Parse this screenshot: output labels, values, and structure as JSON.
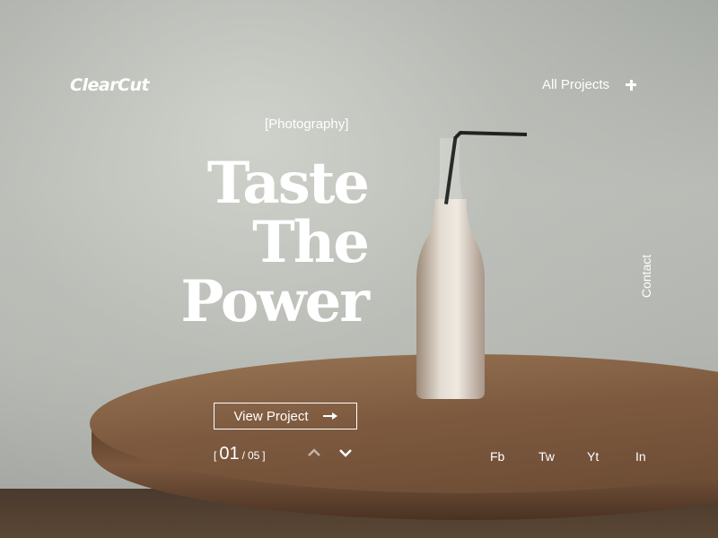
{
  "brand": {
    "logo": "ClearCut"
  },
  "nav": {
    "all_projects": "All Projects"
  },
  "hero": {
    "category": "[Photography]",
    "headline": [
      "Taste",
      "The",
      "Power"
    ],
    "cta": "View Project"
  },
  "side": {
    "contact": "Contact"
  },
  "pager": {
    "open_bracket": "[",
    "current": "01",
    "separator": "/",
    "total": "05",
    "close_bracket": "]"
  },
  "social": [
    "Fb",
    "Tw",
    "Yt",
    "In"
  ],
  "icons": {
    "add": "plus-icon",
    "cta_arrow": "arrow-right-icon",
    "prev": "chevron-up-icon",
    "next": "chevron-down-icon"
  }
}
